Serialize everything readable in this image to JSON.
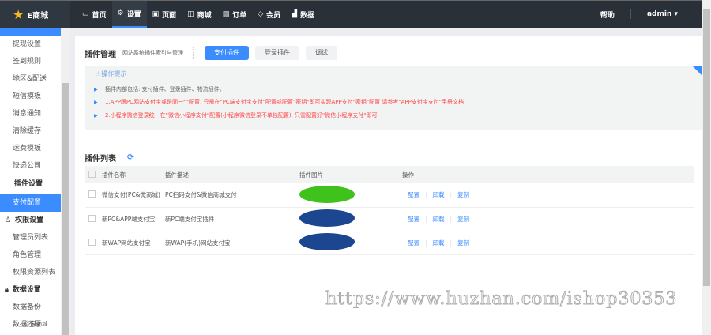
{
  "app": {
    "name": "E商城"
  },
  "nav": [
    {
      "label": "首页",
      "icon": "monitor-icon"
    },
    {
      "label": "设置",
      "icon": "gear-icon"
    },
    {
      "label": "页面",
      "icon": "page-icon"
    },
    {
      "label": "商城",
      "icon": "bag-icon"
    },
    {
      "label": "订单",
      "icon": "order-icon"
    },
    {
      "label": "会员",
      "icon": "diamond-icon"
    },
    {
      "label": "数据",
      "icon": "chart-icon"
    }
  ],
  "top_right": {
    "help": "帮助",
    "user": "admin"
  },
  "sidebar": {
    "items_a": [
      "提现设置",
      "签到规则",
      "地区&配送",
      "短信模板",
      "消息通知",
      "清除缓存",
      "运费模板",
      "快递公司"
    ],
    "group_plugin": "插件设置",
    "active": "支付配置",
    "group_perm": "权限设置",
    "items_b": [
      "管理员列表",
      "角色管理",
      "权限资源列表"
    ],
    "group_data": "数据设置",
    "items_c": [
      "数据备份",
      "数据还原"
    ],
    "copyright": "© 易商城"
  },
  "header": {
    "title": "插件管理",
    "subtitle": "网站系统插件索引与管理",
    "tabs": [
      "支付插件",
      "登录插件",
      "调试"
    ]
  },
  "tips": {
    "title": "操作提示",
    "lines": [
      "插件内部包括: 支付插件、登录插件、物流插件。",
      "1.APP跟PC网站支付宝或是同一个配置, 只需在\"PC端支付宝支付\"配置或配置\"密钥\"即可实现APP支付\"密钥\"配置 请参考\"APP支付宝支付\"手册文档",
      "2.小程序微信登录统一在\"微信小程序支付\"配置(小程序微信登录不单独配置), 只需配置好\"微信小程序支付\"即可"
    ]
  },
  "list": {
    "title": "插件列表",
    "columns": [
      "插件名称",
      "插件描述",
      "插件图片",
      "操作"
    ],
    "rows": [
      {
        "name": "微信支付(PC&微商城)",
        "desc": "PC扫码支付&微信商城支付",
        "color": "#3fc21c"
      },
      {
        "name": "新PC&APP端支付宝",
        "desc": "新PC端支付宝插件",
        "color": "#1d4690"
      },
      {
        "name": "新WAP网站支付宝",
        "desc": "新WAP(手机)网站支付宝",
        "color": "#1d4690"
      }
    ],
    "ops": [
      "配置",
      "卸载",
      "复制"
    ]
  },
  "watermark": "https://www.huzhan.com/ishop30353"
}
